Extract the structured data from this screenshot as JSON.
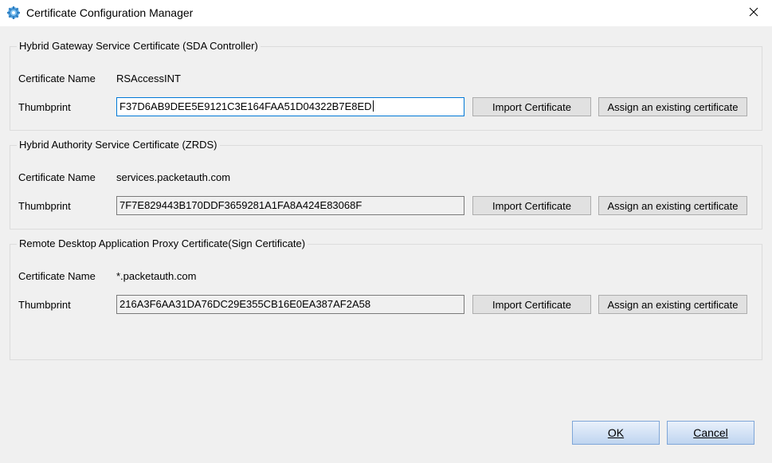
{
  "window": {
    "title": "Certificate Configuration Manager",
    "app_icon": "gear-icon",
    "close_icon": "close-icon"
  },
  "labels": {
    "certificate_name": "Certificate Name",
    "thumbprint": "Thumbprint"
  },
  "buttons": {
    "import": "Import Certificate",
    "assign": "Assign an existing certificate"
  },
  "sections": [
    {
      "title": "Hybrid Gateway Service Certificate (SDA Controller)",
      "certificate_name": "RSAccessINT",
      "thumbprint": "F37D6AB9DEE5E9121C3E164FAA51D04322B7E8ED"
    },
    {
      "title": "Hybrid Authority Service Certificate (ZRDS)",
      "certificate_name": "services.packetauth.com",
      "thumbprint": "7F7E829443B170DDF3659281A1FA8A424E83068F"
    },
    {
      "title": "Remote Desktop Application Proxy Certificate(Sign Certificate)",
      "certificate_name": "*.packetauth.com",
      "thumbprint": "216A3F6AA31DA76DC29E355CB16E0EA387AF2A58"
    }
  ],
  "dialog_buttons": {
    "ok": "OK",
    "cancel": "Cancel"
  },
  "colors": {
    "window_bg": "#f0f0f0",
    "titlebar_bg": "#ffffff",
    "focus_border": "#0078d7",
    "dialog_button_border": "#7ea6d8"
  }
}
